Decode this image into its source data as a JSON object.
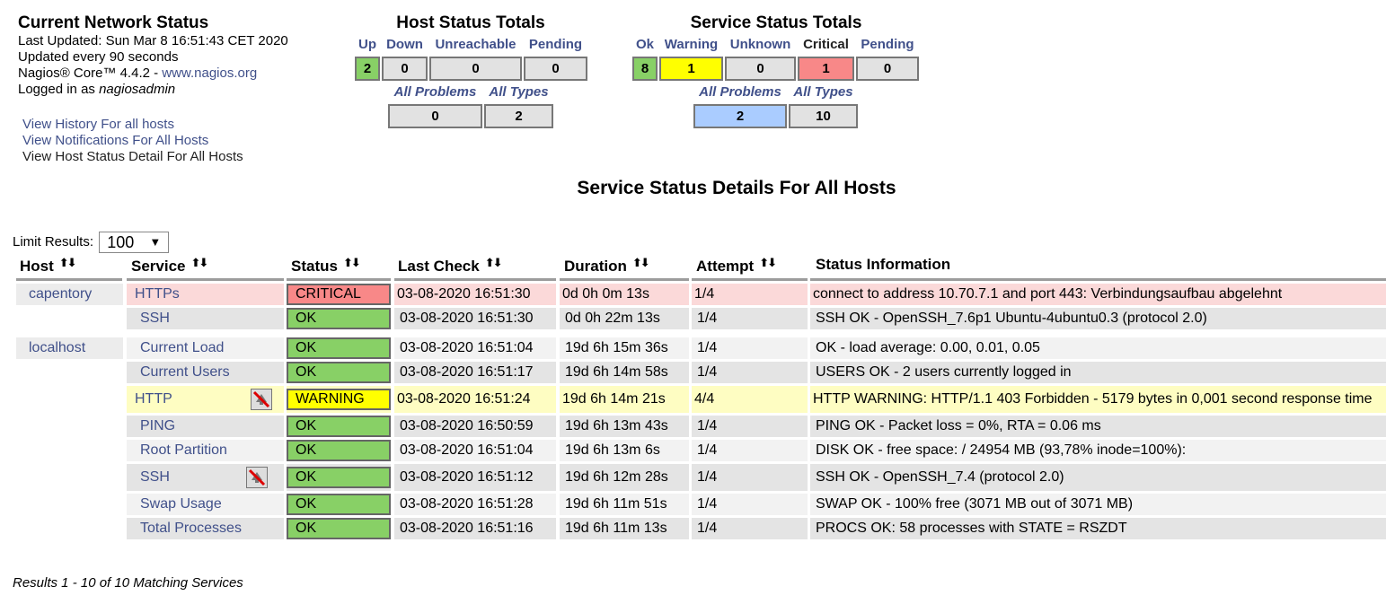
{
  "header": {
    "title": "Current Network Status",
    "last_updated": "Last Updated: Sun Mar 8 16:51:43 CET 2020",
    "update_interval": "Updated every 90 seconds",
    "version_text": "Nagios® Core™ 4.4.2 - ",
    "version_link": "www.nagios.org",
    "logged_in_prefix": "Logged in as ",
    "user": "nagiosadmin"
  },
  "links": [
    "View History For all hosts",
    "View Notifications For All Hosts",
    "View Host Status Detail For All Hosts"
  ],
  "host_totals": {
    "title": "Host Status Totals",
    "headers": [
      "Up",
      "Down",
      "Unreachable",
      "Pending"
    ],
    "values": [
      "2",
      "0",
      "0",
      "0"
    ],
    "sub_headers": [
      "All Problems",
      "All Types"
    ],
    "sub_values": [
      "0",
      "2"
    ]
  },
  "service_totals": {
    "title": "Service Status Totals",
    "headers": [
      "Ok",
      "Warning",
      "Unknown",
      "Critical",
      "Pending"
    ],
    "values": [
      "8",
      "1",
      "0",
      "1",
      "0"
    ],
    "sub_headers": [
      "All Problems",
      "All Types"
    ],
    "sub_values": [
      "2",
      "10"
    ]
  },
  "page_heading": "Service Status Details For All Hosts",
  "limit": {
    "label": "Limit Results:",
    "value": "100"
  },
  "table": {
    "columns": [
      "Host",
      "Service",
      "Status",
      "Last Check",
      "Duration",
      "Attempt",
      "Status Information"
    ],
    "rows": [
      {
        "host": "capentory",
        "service": "HTTPs",
        "status": "CRITICAL",
        "last_check": "03-08-2020 16:51:30",
        "duration": "0d 0h 0m 13s",
        "attempt": "1/4",
        "info": "connect to address 10.70.7.1 and port 443: Verbindungsaufbau abgelehnt"
      },
      {
        "host": "",
        "service": "SSH",
        "status": "OK",
        "last_check": "03-08-2020 16:51:30",
        "duration": "0d 0h 22m 13s",
        "attempt": "1/4",
        "info": "SSH OK - OpenSSH_7.6p1 Ubuntu-4ubuntu0.3 (protocol 2.0)"
      },
      {
        "host": "localhost",
        "service": "Current Load",
        "status": "OK",
        "last_check": "03-08-2020 16:51:04",
        "duration": "19d 6h 15m 36s",
        "attempt": "1/4",
        "info": "OK - load average: 0.00, 0.01, 0.05"
      },
      {
        "host": "",
        "service": "Current Users",
        "status": "OK",
        "last_check": "03-08-2020 16:51:17",
        "duration": "19d 6h 14m 58s",
        "attempt": "1/4",
        "info": "USERS OK - 2 users currently logged in"
      },
      {
        "host": "",
        "service": "HTTP",
        "status": "WARNING",
        "last_check": "03-08-2020 16:51:24",
        "duration": "19d 6h 14m 21s",
        "attempt": "4/4",
        "info": "HTTP WARNING: HTTP/1.1 403 Forbidden - 5179 bytes in 0,001 second response time"
      },
      {
        "host": "",
        "service": "PING",
        "status": "OK",
        "last_check": "03-08-2020 16:50:59",
        "duration": "19d 6h 13m 43s",
        "attempt": "1/4",
        "info": "PING OK - Packet loss = 0%, RTA = 0.06 ms"
      },
      {
        "host": "",
        "service": "Root Partition",
        "status": "OK",
        "last_check": "03-08-2020 16:51:04",
        "duration": "19d 6h 13m 6s",
        "attempt": "1/4",
        "info": "DISK OK - free space: / 24954 MB (93,78% inode=100%):"
      },
      {
        "host": "",
        "service": "SSH",
        "status": "OK",
        "last_check": "03-08-2020 16:51:12",
        "duration": "19d 6h 12m 28s",
        "attempt": "1/4",
        "info": "SSH OK - OpenSSH_7.4 (protocol 2.0)"
      },
      {
        "host": "",
        "service": "Swap Usage",
        "status": "OK",
        "last_check": "03-08-2020 16:51:28",
        "duration": "19d 6h 11m 51s",
        "attempt": "1/4",
        "info": "SWAP OK - 100% free (3071 MB out of 3071 MB)"
      },
      {
        "host": "",
        "service": "Total Processes",
        "status": "OK",
        "last_check": "03-08-2020 16:51:16",
        "duration": "19d 6h 11m 13s",
        "attempt": "1/4",
        "info": "PROCS OK: 58 processes with STATE = RSZDT"
      }
    ]
  },
  "results_text": "Results 1 - 10 of 10 Matching Services",
  "icons": {
    "notifications_disabled": "notifications-disabled-icon",
    "sort": "sort-arrows-icon"
  },
  "colors": {
    "ok": "#88d066",
    "warning": "#ffff00",
    "critical": "#f88888",
    "problems": "#aaccff",
    "link": "#40508a"
  }
}
